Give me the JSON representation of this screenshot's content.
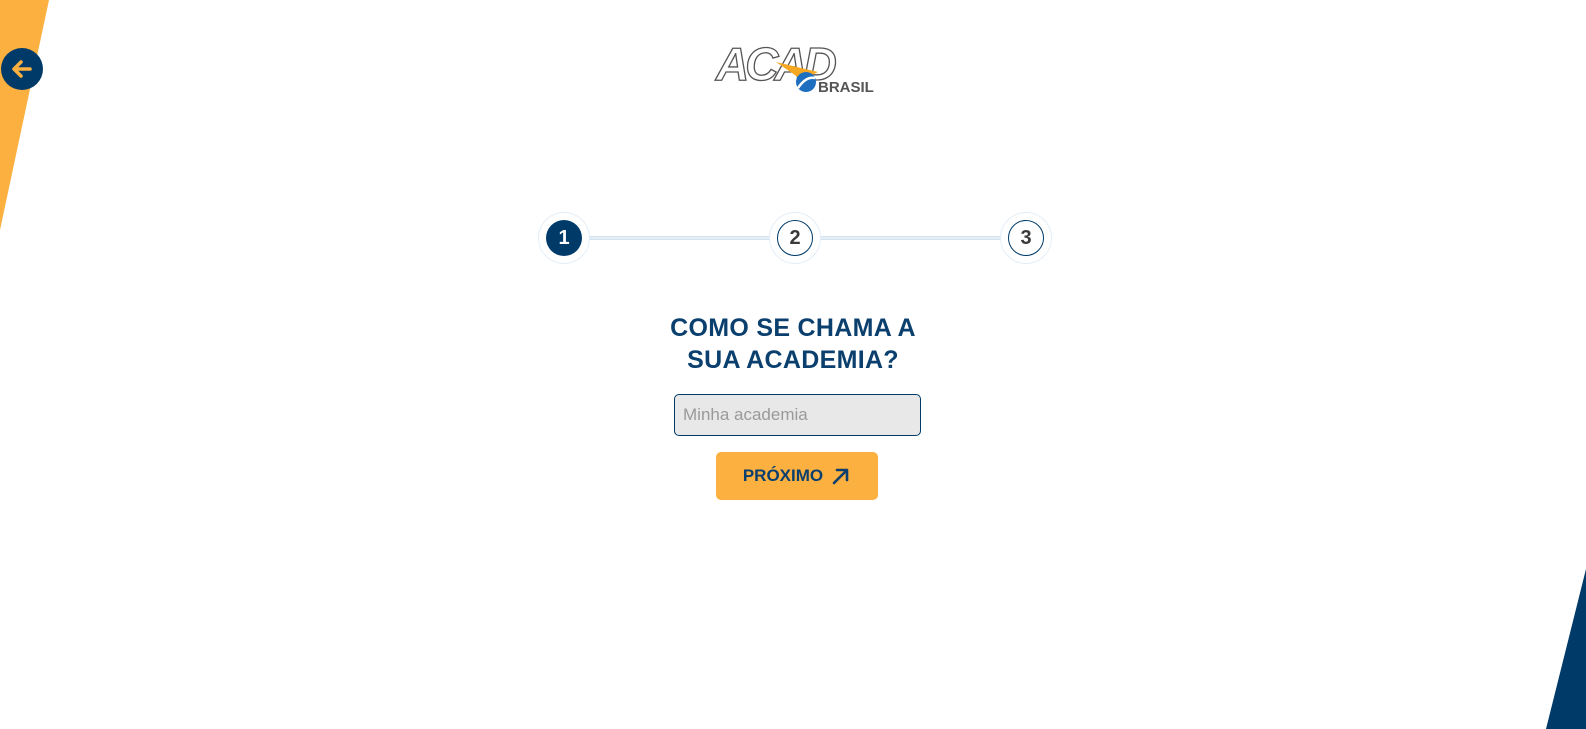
{
  "colors": {
    "brand_blue": "#003a68",
    "brand_orange": "#fbb040"
  },
  "back_button": {
    "icon": "arrow-left-icon"
  },
  "logo": {
    "wordmark": "ACAD",
    "subtitle": "BRASIL"
  },
  "stepper": {
    "current_step": 1,
    "steps": [
      {
        "label": "1",
        "state": "active"
      },
      {
        "label": "2",
        "state": "pending"
      },
      {
        "label": "3",
        "state": "pending"
      }
    ]
  },
  "form": {
    "question_line1": "COMO SE CHAMA A",
    "question_line2": "SUA ACADEMIA?",
    "input_placeholder": "Minha academia",
    "input_value": "",
    "next_label": "PRÓXIMO",
    "next_icon": "arrow-up-right-icon"
  }
}
